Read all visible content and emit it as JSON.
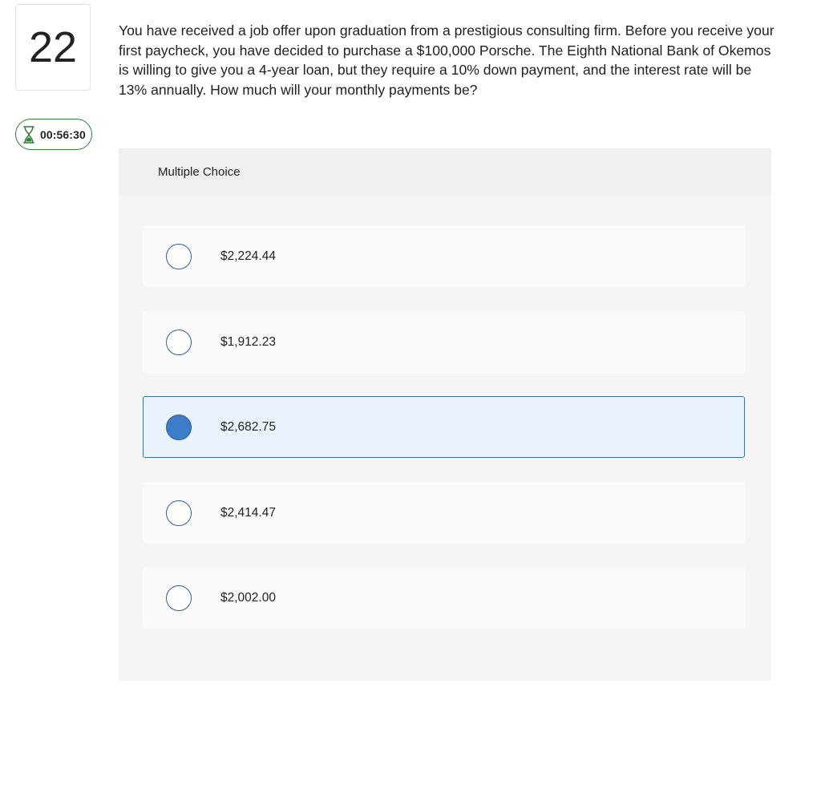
{
  "question": {
    "number": "22",
    "timer": "00:56:30",
    "text": "You have received a job offer upon graduation from a prestigious consulting firm.  Before you receive your first paycheck, you have decided to purchase a $100,000 Porsche.  The Eighth National Bank of Okemos is willing to give you a 4-year loan, but they require a 10% down payment, and the interest rate will be 13% annually. How much will your monthly payments be?"
  },
  "multiple_choice": {
    "header": "Multiple Choice",
    "options": [
      {
        "label": "$2,224.44",
        "selected": false
      },
      {
        "label": "$1,912.23",
        "selected": false
      },
      {
        "label": "$2,682.75",
        "selected": true
      },
      {
        "label": "$2,414.47",
        "selected": false
      },
      {
        "label": "$2,002.00",
        "selected": false
      }
    ]
  },
  "colors": {
    "accent": "#3d7cc9",
    "timer_border": "#2e7d32",
    "selected_bg": "#eaf3fc"
  },
  "icons": {
    "timer": "hourglass-icon"
  }
}
